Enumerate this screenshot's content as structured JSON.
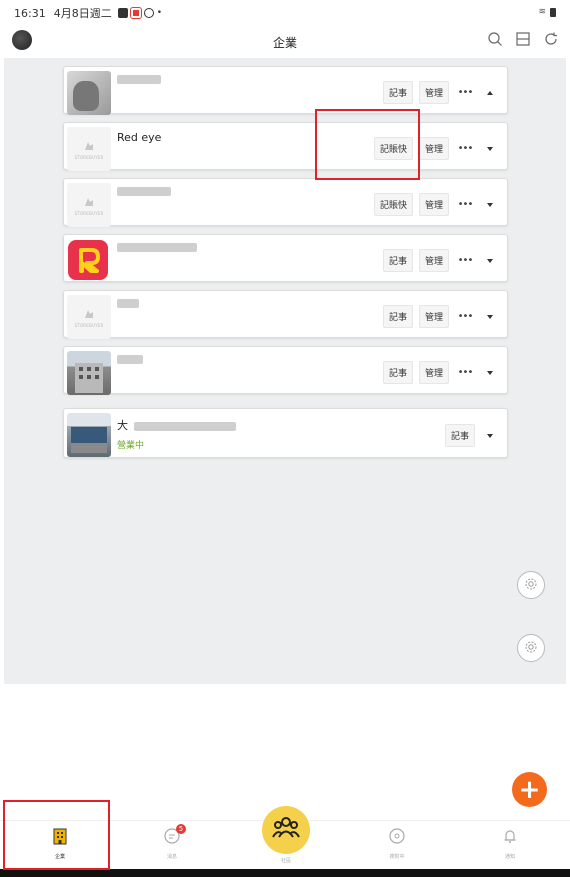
{
  "status_bar": {
    "time": "16:31",
    "date": "4月8日週二"
  },
  "header": {
    "title": "企業"
  },
  "buttons": {
    "record": "記事",
    "manage": "管理",
    "quick_record": "記賬快",
    "more": "•••"
  },
  "businesses": [
    {
      "name": "",
      "icon": "blurred-photo",
      "expanded": true
    },
    {
      "name": "Red eye",
      "icon": "store-placeholder-icon"
    },
    {
      "name": "",
      "icon": "store-placeholder-icon"
    },
    {
      "name": "",
      "icon": "r-logo"
    },
    {
      "name": "",
      "icon": "store-placeholder-icon"
    },
    {
      "name": "",
      "icon": "building-photo"
    },
    {
      "name": "大",
      "icon": "storefront-photo",
      "status": "營業中"
    }
  ],
  "tabs": [
    {
      "label": "企業",
      "icon": "building-icon",
      "active": true
    },
    {
      "label": "消息",
      "icon": "chat-icon",
      "badge": "5"
    },
    {
      "label": "社區",
      "icon": "community-icon"
    },
    {
      "label": "搜附中",
      "icon": "compass-icon"
    },
    {
      "label": "通知",
      "icon": "bell-icon"
    }
  ],
  "colors": {
    "accent_orange": "#f36a1d",
    "center_yellow": "#f5d04a",
    "open_green": "#6aa82a",
    "highlight_red": "#e0202a",
    "background_gray": "#eceeef"
  }
}
